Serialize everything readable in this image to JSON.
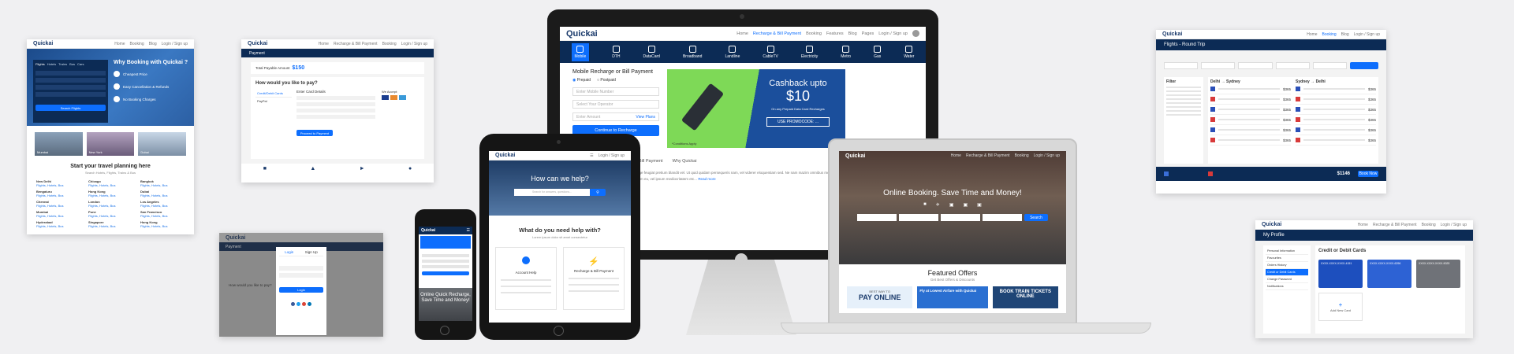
{
  "brand": "Quickai",
  "nav_items": [
    "Home",
    "Recharge & Bill Payment",
    "Booking",
    "Features",
    "Blog",
    "Pages"
  ],
  "login_label": "Login / Sign up",
  "card1": {
    "hero_title": "Why Booking with Quickai ?",
    "tabs": [
      "Flights",
      "Hotels",
      "Trains",
      "Bus",
      "Cars"
    ],
    "features": [
      "Cheapest Price",
      "Easy Cancellation & Refunds",
      "No Booking Charges"
    ],
    "search_label": "Search Flights",
    "section_title": "Start your travel planning here",
    "section_sub": "Search Hotels, Flights, Trains & Bus",
    "images": [
      "Mumbai",
      "New York",
      "Dubai"
    ],
    "cities": [
      [
        "New Delhi",
        "Chicago",
        "Bangkok"
      ],
      [
        "Bengaluru",
        "Hong Kong",
        "Dubai"
      ],
      [
        "Chennai",
        "London",
        "Los Angeles"
      ],
      [
        "Mumbai",
        "Pune",
        "San Francisco"
      ],
      [
        "Hyderabad",
        "Singapore",
        "Hong Kong"
      ]
    ],
    "city_sub": "Flights, Hotels, Bus"
  },
  "card2": {
    "header": "Payment",
    "amount_label": "Total Payable Amount",
    "amount": "$150",
    "question": "How would you like to pay?",
    "methods": [
      "Credit/Debit Cards",
      "PayPal"
    ],
    "form_title": "Enter Card Details",
    "proceed": "Proceed to Payment",
    "we_accept": "We Accept:"
  },
  "card3": {
    "header": "Payment",
    "tabs": [
      "Login",
      "Sign Up"
    ],
    "login_btn": "Login",
    "question": "How would you like to pay?"
  },
  "card4": {
    "header": "Flights - Round Trip",
    "filter": "Filter",
    "route1": "Delhi → Sydney",
    "route2": "Sydney → Delhi",
    "total": "$1146",
    "book": "Book Now",
    "prices": [
      "$365",
      "$365",
      "$365",
      "$365",
      "$365",
      "$365"
    ]
  },
  "card5": {
    "header": "My Profile",
    "menu": [
      "Personal Information",
      "Favourites",
      "Orders History",
      "Credit or Debit Cards",
      "Change Password",
      "Notifications"
    ],
    "section_title": "Credit or Debit Cards",
    "cards": [
      "XXXX-XXXX-XXXX-4151",
      "XXXX-XXXX-XXXX-6296",
      "XXXX-XXXX-XXXX-9025"
    ],
    "add_card": "Add New Card"
  },
  "monitor": {
    "logo": "Quickai",
    "services": [
      "Mobile",
      "DTH",
      "DataCard",
      "Broadband",
      "Landline",
      "CableTV",
      "Electricity",
      "Metro",
      "Gas",
      "Water"
    ],
    "form_title": "Mobile Recharge or Bill Payment",
    "radio_prepaid": "Prepaid",
    "radio_postpaid": "Postpaid",
    "field_mobile": "Enter Mobile Number",
    "field_operator": "Select Your Operator",
    "field_amount": "Enter Amount",
    "view_plans": "View Plans",
    "continue": "Continue to Recharge",
    "promo_title": "Cashback upto",
    "promo_amount": "$10",
    "promo_sub": "On any Prepaid Data Card Recharges",
    "promo_code": "USE PROMOCODE: ...",
    "conditions": "*Conditions Apply",
    "tabs": [
      "Bill Payment",
      "Why Quickai"
    ],
    "paragraph": "Recharge feugiat pretium blandit vel. Ut quid quidam persequeris nam, vel viderer eloquentiam sed. Ne nam mazim omnibus mea, sed at nominavi temporibus, in iriure. Ius nibh petentium eu, vel ipsum mediocritatem etc...",
    "read_more": "Read more"
  },
  "laptop": {
    "logo": "Quickai",
    "hero": "Online Booking. Save Time and Money!",
    "search": "Search",
    "featured": "Featured Offers",
    "featured_sub": "Get Best Offers & Discounts",
    "offers": [
      "PAY ONLINE",
      "Fly at Lowest Airfare with Quickai",
      "BOOK TRAIN TICKETS ONLINE"
    ],
    "offer_top": "BEST WAY TO"
  },
  "ipad": {
    "logo": "Quickai",
    "login": "Login / Sign up",
    "hero": "How can we help?",
    "search_ph": "Search for answers, questions...",
    "section": "What do you need help with?",
    "section_sub": "Lorem ipsum dolor sit amet consectetur",
    "tiles": [
      "Account Help",
      "Recharge & Bill Payment"
    ]
  },
  "iphone": {
    "logo": "Quickai",
    "overlay": "Online Quick Recharge, Save Time and Money!"
  },
  "colors": {
    "navy": "#0c2b55",
    "accent": "#0d6efd",
    "promo": "#7ed957"
  }
}
